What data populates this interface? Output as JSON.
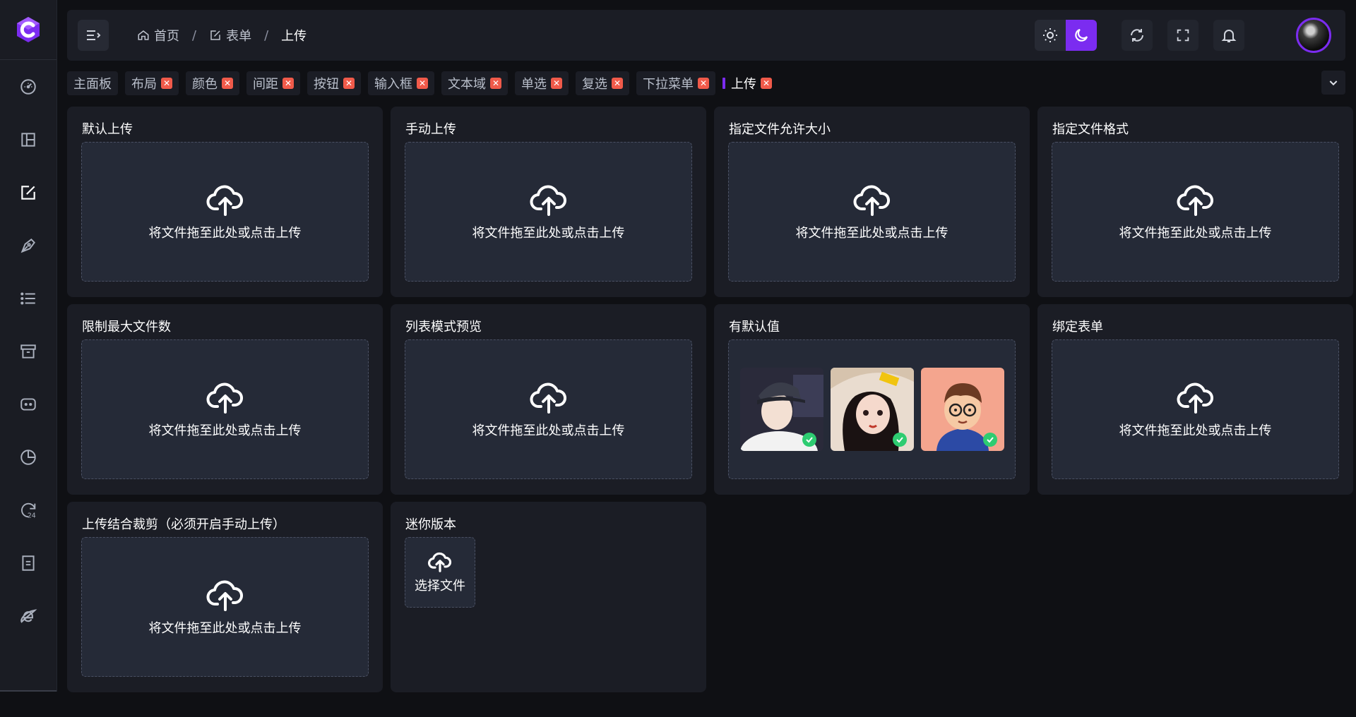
{
  "app": {
    "logo_letter": "C"
  },
  "sidebar": {
    "items": [
      {
        "icon": "dashboard-icon"
      },
      {
        "icon": "layout-icon"
      },
      {
        "icon": "form-edit-icon",
        "active": true
      },
      {
        "icon": "pen-icon"
      },
      {
        "icon": "list-icon"
      },
      {
        "icon": "archive-icon"
      },
      {
        "icon": "chat-icon"
      },
      {
        "icon": "pie-chart-icon"
      },
      {
        "icon": "24h-icon"
      },
      {
        "icon": "document-icon"
      },
      {
        "icon": "ie-browser-icon"
      }
    ]
  },
  "header": {
    "breadcrumb": [
      {
        "label": "首页",
        "icon": "home-icon"
      },
      {
        "label": "表单",
        "icon": "form-icon"
      },
      {
        "label": "上传"
      }
    ],
    "separator": "/",
    "theme": "dark"
  },
  "tabs": [
    {
      "label": "主面板",
      "closable": false
    },
    {
      "label": "布局",
      "closable": true
    },
    {
      "label": "颜色",
      "closable": true
    },
    {
      "label": "间距",
      "closable": true
    },
    {
      "label": "按钮",
      "closable": true
    },
    {
      "label": "输入框",
      "closable": true
    },
    {
      "label": "文本域",
      "closable": true
    },
    {
      "label": "单选",
      "closable": true
    },
    {
      "label": "复选",
      "closable": true
    },
    {
      "label": "下拉菜单",
      "closable": true
    },
    {
      "label": "上传",
      "closable": true,
      "active": true
    }
  ],
  "tab_close_glyph": "✕",
  "dropzone_text": "将文件拖至此处或点击上传",
  "cards": {
    "c1": {
      "title": "默认上传"
    },
    "c2": {
      "title": "手动上传"
    },
    "c3": {
      "title": "指定文件允许大小"
    },
    "c4": {
      "title": "指定文件格式"
    },
    "c5": {
      "title": "限制最大文件数"
    },
    "c6": {
      "title": "列表模式预览"
    },
    "c7": {
      "title": "有默认值"
    },
    "c8": {
      "title": "绑定表单"
    },
    "c9": {
      "title": "上传结合裁剪（必须开启手动上传）"
    },
    "c10": {
      "title": "迷你版本",
      "button_text": "选择文件"
    }
  },
  "colors": {
    "accent": "#7b2cf0",
    "close": "#f05a4a",
    "success": "#2ecc71",
    "card_bg": "#1b1d25",
    "dropzone_bg": "#252a37"
  }
}
